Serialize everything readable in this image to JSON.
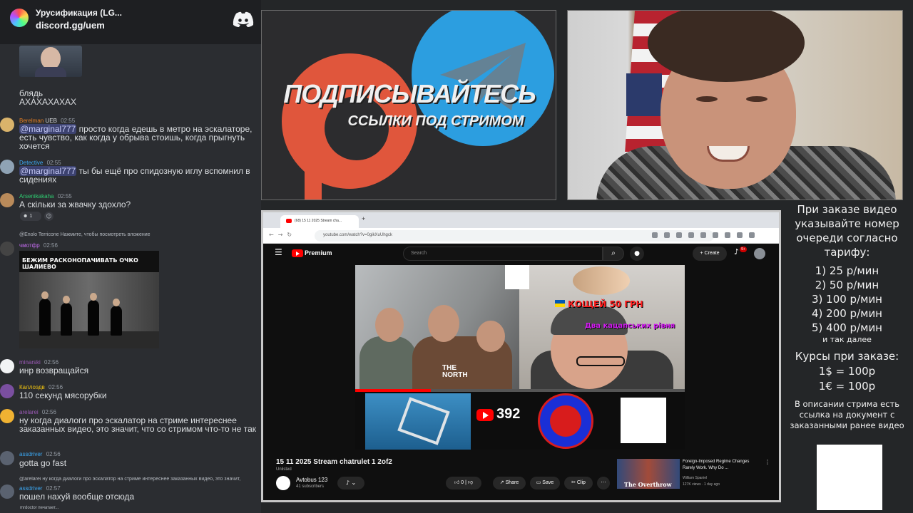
{
  "discord": {
    "server_name": "Урусификация (LG...",
    "invite": "discord.gg/uem",
    "typing": "mrdoctor печатает...",
    "messages": [
      {
        "text": "блядь\nАХАХАХАХАХ"
      },
      {
        "author": "Berelman",
        "badge": "UEB",
        "time": "02:55",
        "author_color": "#e67e22",
        "mention": "@marginal777",
        "text": " просто когда едешь в метро на эскалаторе, есть чувство, как когда у обрыва стоишь, когда прыгнуть хочется"
      },
      {
        "author": "Detective",
        "time": "02:55",
        "author_color": "#3ba9f5",
        "mention": "@marginal777",
        "text": " ты бы ещё про спидозную иглу вспомнил в сидениях"
      },
      {
        "author": "Arsenikakaha",
        "time": "02:55",
        "author_color": "#2ecc71",
        "text": "А скільки за жвачку здохло?",
        "reaction": "1"
      },
      {
        "reply": "@Enolo Terricone  Нажмите, чтобы посмотреть вложение",
        "author": "чмотфр",
        "time": "02:56",
        "author_color": "#c56cf0",
        "image_caption": "БЕЖИМ РАСКОНОПАЧИВАТЬ ОЧКО ШАЛИЕВО"
      },
      {
        "author": "minarski",
        "time": "02:56",
        "author_color": "#9b59b6",
        "text": "инр возвращайся"
      },
      {
        "author": "Каллоэдв",
        "time": "02:56",
        "author_color": "#f1c40f",
        "text": "110 секунд мясорубки"
      },
      {
        "author": "arelarei",
        "time": "02:56",
        "author_color": "#9b59b6",
        "text": "ну когда диалоги про эскалатор на стриме интереснее заказанных видео, это значит, что со стримом что-то не так"
      },
      {
        "author": "assdriver",
        "time": "02:56",
        "author_color": "#3ba9f5",
        "text": "gotta go fast"
      },
      {
        "reply": "@arelarei ну когда диалоги про эскалатор на стриме интереснее заказанных видео, это значит,",
        "author": "assdriver",
        "time": "02:57",
        "author_color": "#3ba9f5",
        "text": "пошел нахуй вообще отсюда"
      }
    ]
  },
  "promo": {
    "title": "ПОДПИСЫВАЙТЕСЬ",
    "subtitle": "ССЫЛКИ ПОД СТРИМОМ"
  },
  "browser": {
    "tab_title": "(68) 15 11 2025 Stream cha...",
    "url": "youtube.com/watch?v=0gikXuUhgck",
    "search_placeholder": "Search",
    "premium_label": "Premium",
    "create_label": "Create",
    "notifications": "9+",
    "overlay": {
      "koschey": "КОЩЕЙ 50 ГРН",
      "katsaps": "Два кацапських рівня",
      "sub_count": "392",
      "shirt_text": "THE\nNORTH",
      "progress": 0.23
    },
    "video_title": "15 11 2025 Stream chatrulet 1 2of2",
    "visibility": "Unlisted",
    "channel_name": "Avtobus 123",
    "channel_subs": "41 subscribers",
    "likes": "0",
    "share_label": "Share",
    "save_label": "Save",
    "clip_label": "Clip",
    "recommended": {
      "title": "Foreign-Imposed Regime Changes Rarely Work. Why Do ...",
      "author": "William Spaniel",
      "meta": "127K views · 1 day ago",
      "thumb_text": "The Overthrow"
    }
  },
  "pricing": {
    "intro": "При заказе видео указывайте номер очереди согласно тарифу:",
    "tiers": [
      "1) 25 р/мин",
      "2) 50 р/мин",
      "3) 100 р/мин",
      "4) 200 р/мин",
      "5) 400 р/мин"
    ],
    "etc": "и так далее",
    "courses_title": "Курсы при заказе:",
    "courses": [
      "1$ = 100р",
      "1€ = 100р"
    ],
    "note": "В описании стрима есть ссылка на документ с заказанными ранее видео"
  },
  "colors": {
    "discord_bg": "#2b2d31",
    "mention_bg": "#3c4270",
    "youtube_red": "#ff0000",
    "patreon": "#e0563c",
    "telegram": "#2c9ee0"
  }
}
